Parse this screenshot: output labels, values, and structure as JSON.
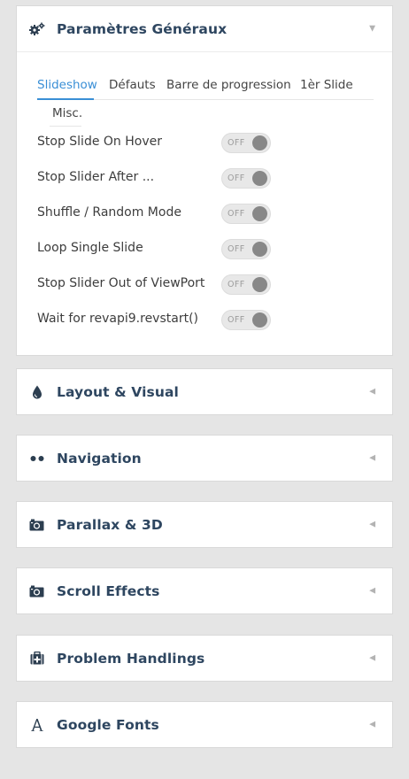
{
  "panels": {
    "general": {
      "title": "Paramètres Généraux",
      "arrow": "▼",
      "icon": "gears-icon"
    },
    "layout": {
      "title": "Layout & Visual",
      "arrow": "◀",
      "icon": "droplet-icon"
    },
    "navigation": {
      "title": "Navigation",
      "arrow": "◀",
      "icon": "dots-icon"
    },
    "parallax": {
      "title": "Parallax & 3D",
      "arrow": "◀",
      "icon": "camera-icon"
    },
    "scroll": {
      "title": "Scroll Effects",
      "arrow": "◀",
      "icon": "camera-icon"
    },
    "problem": {
      "title": "Problem Handlings",
      "arrow": "◀",
      "icon": "medkit-icon"
    },
    "fonts": {
      "title": "Google Fonts",
      "arrow": "◀",
      "icon": "font-a-icon"
    }
  },
  "tabs": [
    {
      "label": "Slideshow",
      "active": true
    },
    {
      "label": "Défauts",
      "active": false
    },
    {
      "label": "Barre de progression",
      "active": false
    },
    {
      "label": "1èr Slide",
      "active": false
    },
    {
      "label": "Misc.",
      "active": false
    }
  ],
  "settings": [
    {
      "label": "Stop Slide On Hover",
      "state": "OFF"
    },
    {
      "label": "Stop Slider After ...",
      "state": "OFF"
    },
    {
      "label": "Shuffle / Random Mode",
      "state": "OFF"
    },
    {
      "label": "Loop Single Slide",
      "state": "OFF"
    },
    {
      "label": "Stop Slider Out of ViewPort",
      "state": "OFF"
    },
    {
      "label": "Wait for revapi9.revstart()",
      "state": "OFF"
    }
  ],
  "colors": {
    "accent": "#3a8fd6",
    "title": "#2e4660",
    "background": "#e5e5e5"
  }
}
